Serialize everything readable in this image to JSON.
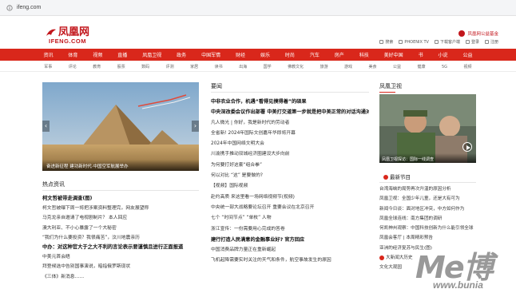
{
  "browser": {
    "url": "ifeng.com"
  },
  "header": {
    "logo_cn": "凤凰网",
    "logo_en": "IFENG.COM",
    "promo": "凤凰网公益基金",
    "tools": [
      "搜索",
      "PHOENIX TV",
      "下载客户端",
      "登录",
      "注册"
    ]
  },
  "nav": [
    "资讯",
    "体育",
    "视频",
    "直播",
    "凤凰卫视",
    "政务",
    "中国军情",
    "财经",
    "娱乐",
    "时尚",
    "汽车",
    "房产",
    "科技",
    "美好中国",
    "书",
    "小说",
    "公益"
  ],
  "subnav": [
    "军事",
    "评论",
    "教育",
    "股票",
    "数码",
    "评测",
    "家居",
    "读书",
    "出海",
    "国学",
    "佛教文化",
    "旅游",
    "游戏",
    "美食",
    "公益",
    "健康",
    "5G",
    "视频"
  ],
  "slider": {
    "caption": "奋进新征程 建功新时代·中国空军航展举办",
    "prev": "‹",
    "next": "›"
  },
  "left_section": {
    "title": "热点资讯"
  },
  "left_list": [
    "柯文哲被带走调查(图)",
    "柯文哲被曝下周一将把涉案资料整理完，网友展望称",
    "马克龙亲自邀请了电视剧制片？ 本人回应",
    "澳大利亚、不小心暴露了一个大秘密",
    "“我们为什么要投资？我很痛苦”，汶川地震亲历",
    "中办：对这种官大于之大不利的言论表示要谨慎且进行正面报道",
    "中美元首会晤",
    "拜登候选中告别国事演说，暗指俄罗斯现状",
    "《三体》新消息……"
  ],
  "mid_section": {
    "title": "要闻"
  },
  "mid_list": [
    "中非农业合作，机遇“看得见摸得着”的硕果",
    "中央深改委会议作出部署  中美打交道第一步就是把中美正常的对话沟通对外",
    "凡人微光 | 你好，我是新时代的劳动者",
    "全省新! 2024年国际文创嘉年华即将开幕",
    "2024年中国网络文明大会",
    "川渝携手推动双城经济圈建设大步向前",
    "为何要打好这套“组合拳”",
    "何以对比 “这” 是要做的?",
    "【视频】国际视频",
    "赴约高质 来这里看一场网络视频节(视频)",
    "中央统一部大战略要论坛召开 重要会议在北京召开",
    "七个 “时间节点” “单枚” 人物",
    "浙江宣传：一份需要用心完成的答卷",
    "建行打造人民满意的金融事业好? 官方回应",
    "中国消费品牌力量正在重新崛起",
    "飞机起降需要实时关注的天气和条件，航空事故发生的原因"
  ],
  "right_section": {
    "title": "凤凰卫视"
  },
  "tv": {
    "caption": "凤凰卫视探访：国际一线调查"
  },
  "right_section2": {
    "title": "最新节目"
  },
  "right_list": [
    "台湾海峡的局势再次升温的原因分析",
    "凤凰卫视：全国少年儿童，还是大有可为",
    "新闻今日谈：面对地区冲突，中方如何作为",
    "凤凰全球连线：南方集团的调研",
    "何凯神州观察：中国科技创新为什么能引领全球",
    "凤凰会客厅 | 本周精彩预告",
    "亚洲的经济复苏与民生(图)",
    "大新闻大历史",
    "文化大观园"
  ],
  "watermark": {
    "big": "Me博",
    "small": "www.bunia"
  }
}
